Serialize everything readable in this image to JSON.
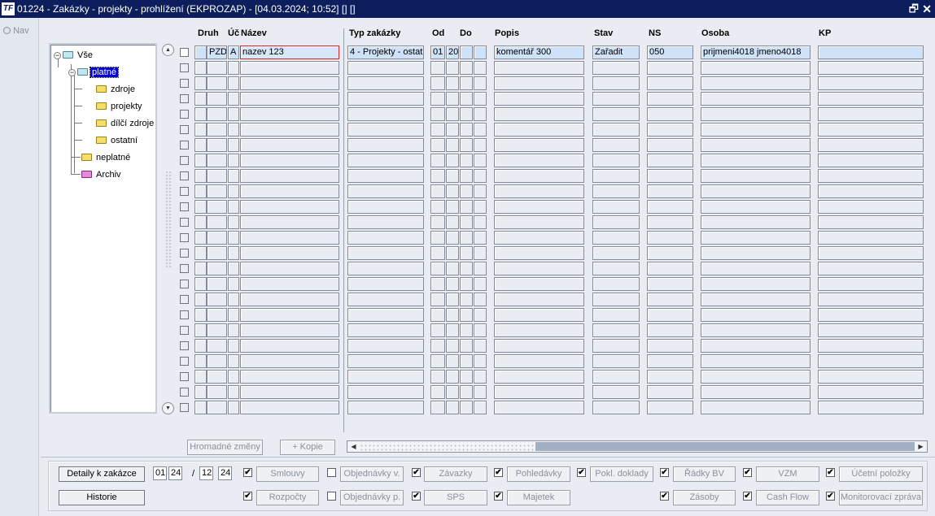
{
  "window": {
    "title": "01224 - Zakázky - projekty - prohlížení (EKPROZAP) - [04.03.2024; 10:52] [] []",
    "app_icon": "TF",
    "restore_glyph": "🗗",
    "close_glyph": "✕"
  },
  "nav": {
    "label": "Nav"
  },
  "tree": {
    "root": {
      "label": "Vše",
      "toggle": "−"
    },
    "platne": {
      "label": "platné",
      "toggle": "−"
    },
    "children": [
      {
        "label": "zdroje"
      },
      {
        "label": "projekty"
      },
      {
        "label": "dílčí zdroje"
      },
      {
        "label": "ostatní"
      }
    ],
    "neplatne": {
      "label": "neplatné"
    },
    "archiv": {
      "label": "Archiv"
    }
  },
  "scroll": {
    "up_glyph": "▲",
    "down_glyph": "▼",
    "left_glyph": "◀",
    "right_glyph": "▶"
  },
  "grid": {
    "headers": {
      "druh": "Druh",
      "uc": "Úč",
      "nazev": "Název",
      "typ": "Typ zakázky",
      "od": "Od",
      "do": "Do",
      "popis": "Popis",
      "stav": "Stav",
      "ns": "NS",
      "osoba": "Osoba",
      "kp": "KP"
    },
    "first_row": {
      "druh": "PZD",
      "uc": "A",
      "nazev": "nazev 123",
      "typ": "4 - Projekty - ostat",
      "od": "01",
      "do": "20",
      "popis": "komentář 300",
      "stav": "Zařadit",
      "ns": "050",
      "osoba": "prijmeni4018 jmeno4018",
      "kp": ""
    },
    "row_count": 24
  },
  "grid_buttons": {
    "hromadne": "Hromadné změny",
    "kopie": "+ Kopie"
  },
  "bottom": {
    "detail_button": "Detaily k zakázce",
    "historie_button": "Historie",
    "period_from_month": "01",
    "period_from_year": "24",
    "period_sep": "/",
    "period_to_month": "12",
    "period_to_year": "24",
    "check_glyph": "✔",
    "links": [
      {
        "label": "Smlouvy",
        "checked": true
      },
      {
        "label": "Objednávky v.",
        "checked": false
      },
      {
        "label": "Závazky",
        "checked": true
      },
      {
        "label": "Pohledávky",
        "checked": true
      },
      {
        "label": "Pokl. doklady",
        "checked": true
      },
      {
        "label": "Řádky BV",
        "checked": true
      },
      {
        "label": "VZM",
        "checked": true
      },
      {
        "label": "Účetní položky",
        "checked": true
      },
      {
        "label": "Rozpočty",
        "checked": true
      },
      {
        "label": "Objednávky p.",
        "checked": false
      },
      {
        "label": "SPS",
        "checked": true
      },
      {
        "label": "Majetek",
        "checked": true
      },
      {
        "label": "Zásoby",
        "checked": true
      },
      {
        "label": "Cash Flow",
        "checked": true
      },
      {
        "label": "Monitorovací zpráva",
        "checked": true
      }
    ]
  }
}
